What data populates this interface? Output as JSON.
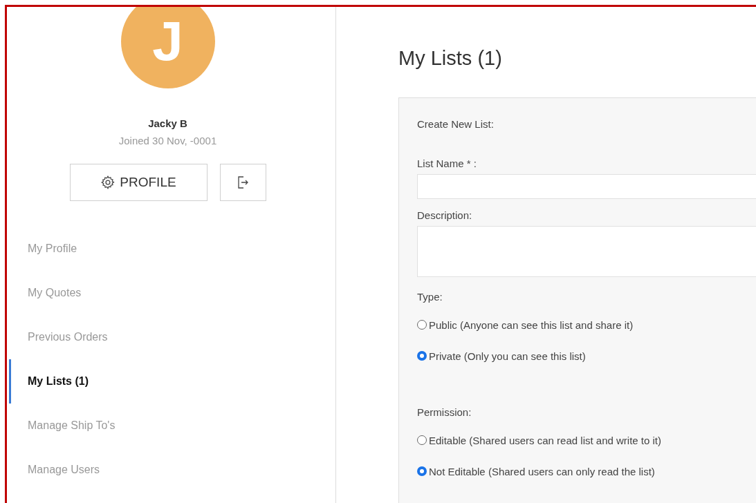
{
  "user": {
    "initial": "J",
    "name": "Jacky B",
    "joined": "Joined 30 Nov, -0001"
  },
  "profile_button": "PROFILE",
  "sidebar": {
    "items": [
      {
        "label": "My Profile",
        "selected": false
      },
      {
        "label": "My Quotes",
        "selected": false
      },
      {
        "label": "Previous Orders",
        "selected": false
      },
      {
        "label": "My Lists (1)",
        "selected": true
      },
      {
        "label": "Manage Ship To's",
        "selected": false
      },
      {
        "label": "Manage Users",
        "selected": false
      }
    ]
  },
  "page_title": "My Lists (1)",
  "form": {
    "heading": "Create New List:",
    "list_name_label": "List Name * :",
    "description_label": "Description:",
    "groups": [
      {
        "label": "Type:",
        "options": [
          {
            "label": "Public (Anyone can see this list and share it)",
            "selected": false
          },
          {
            "label": "Private (Only you can see this list)",
            "selected": true
          }
        ]
      },
      {
        "label": "Permission:",
        "options": [
          {
            "label": "Editable (Shared users can read list and write to it)",
            "selected": false
          },
          {
            "label": "Not Editable (Shared users can only read the list)",
            "selected": true
          }
        ]
      }
    ]
  }
}
